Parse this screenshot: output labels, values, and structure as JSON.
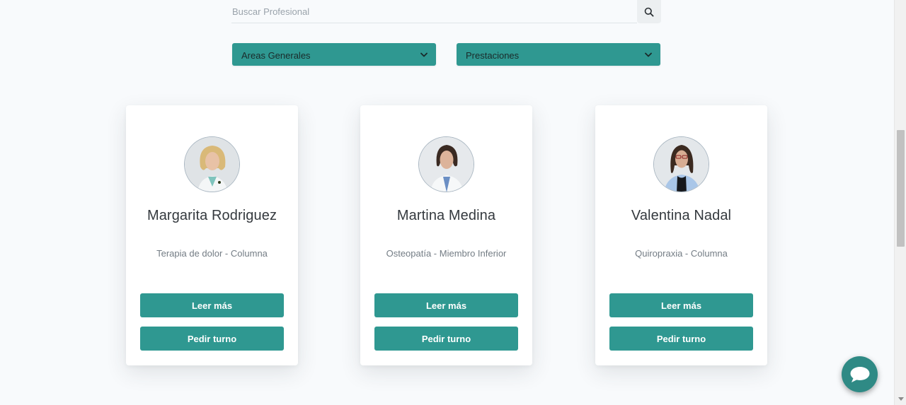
{
  "search": {
    "placeholder": "Buscar Profesional",
    "icon": "search-icon"
  },
  "filters": {
    "areas_label": "Areas Generales",
    "prestaciones_label": "Prestaciones"
  },
  "professionals": [
    {
      "name": "Margarita Rodriguez",
      "specialty": "Terapia de dolor - Columna",
      "read_more_label": "Leer más",
      "book_label": "Pedir turno"
    },
    {
      "name": "Martina Medina",
      "specialty": "Osteopatía - Miembro Inferior",
      "read_more_label": "Leer más",
      "book_label": "Pedir turno"
    },
    {
      "name": "Valentina Nadal",
      "specialty": "Quiropraxia - Columna",
      "read_more_label": "Leer más",
      "book_label": "Pedir turno"
    }
  ],
  "chat": {
    "icon": "chat-bubble-icon"
  },
  "colors": {
    "accent": "#2f9891",
    "background": "#f8fafc",
    "card": "#ffffff"
  }
}
